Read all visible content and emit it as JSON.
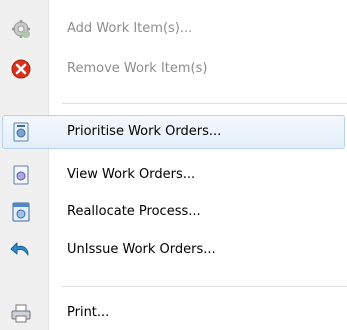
{
  "menu": {
    "items": [
      {
        "label": "Add Work Item(s)...",
        "icon": "gear-add-icon",
        "enabled": false
      },
      {
        "label": "Remove Work Item(s)",
        "icon": "remove-circle-icon",
        "enabled": false
      },
      {
        "label": "Prioritise Work Orders...",
        "icon": "prioritise-icon",
        "enabled": true,
        "highlighted": true
      },
      {
        "label": "View Work Orders...",
        "icon": "view-document-icon",
        "enabled": true
      },
      {
        "label": "Reallocate Process...",
        "icon": "reallocate-icon",
        "enabled": true
      },
      {
        "label": "UnIssue Work Orders...",
        "icon": "undo-arrow-icon",
        "enabled": true
      },
      {
        "label": "Print...",
        "icon": "printer-icon",
        "enabled": true
      }
    ]
  },
  "colors": {
    "highlight_border": "#b6d3ef",
    "disabled_text": "#8d8d8d",
    "remove_red": "#d8321e"
  }
}
